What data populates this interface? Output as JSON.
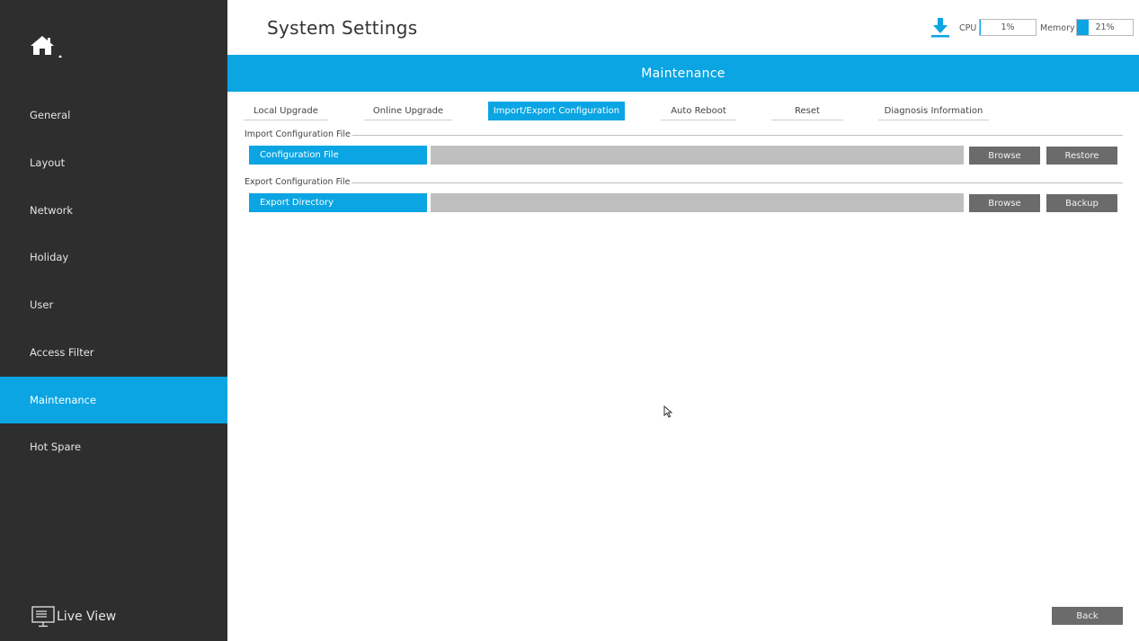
{
  "header": {
    "title": "System Settings",
    "cpu_label": "CPU",
    "cpu_value": "1%",
    "cpu_fraction": 0.01,
    "memory_label": "Memory",
    "memory_value": "21%",
    "memory_fraction": 0.21
  },
  "sidebar": {
    "home_icon": "home-icon",
    "items": [
      {
        "label": "General"
      },
      {
        "label": "Layout"
      },
      {
        "label": "Network"
      },
      {
        "label": "Holiday"
      },
      {
        "label": "User"
      },
      {
        "label": "Access Filter"
      },
      {
        "label": "Maintenance",
        "active": true
      },
      {
        "label": "Hot Spare"
      }
    ],
    "live_view_label": "Live View"
  },
  "banner": {
    "title": "Maintenance"
  },
  "tabs": [
    {
      "label": "Local Upgrade"
    },
    {
      "label": "Online Upgrade"
    },
    {
      "label": "Import/Export Configuration",
      "active": true
    },
    {
      "label": "Auto Reboot"
    },
    {
      "label": "Reset"
    },
    {
      "label": "Diagnosis Information"
    }
  ],
  "import_section": {
    "title": "Import Configuration File",
    "field_label": "Configuration File",
    "field_value": "",
    "browse_label": "Browse",
    "action_label": "Restore"
  },
  "export_section": {
    "title": "Export Configuration File",
    "field_label": "Export Directory",
    "field_value": "",
    "browse_label": "Browse",
    "action_label": "Backup"
  },
  "footer": {
    "back_label": "Back"
  },
  "colors": {
    "accent": "#0aa5e2",
    "sidebar_bg": "#2e2e2e",
    "button_bg": "#6b6b6b",
    "input_bg": "#bfbfbf"
  }
}
